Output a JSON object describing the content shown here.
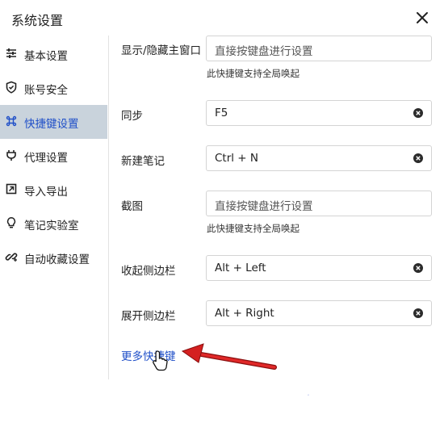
{
  "window": {
    "title": "系统设置"
  },
  "sidebar": {
    "items": [
      {
        "label": "基本设置",
        "icon": "sliders-icon",
        "active": false
      },
      {
        "label": "账号安全",
        "icon": "shield-icon",
        "active": false
      },
      {
        "label": "快捷键设置",
        "icon": "command-icon",
        "active": true
      },
      {
        "label": "代理设置",
        "icon": "plug-icon",
        "active": false
      },
      {
        "label": "导入导出",
        "icon": "import-export-icon",
        "active": false
      },
      {
        "label": "笔记实验室",
        "icon": "lightbulb-icon",
        "active": false
      },
      {
        "label": "自动收藏设置",
        "icon": "bookmark-link-icon",
        "active": false
      }
    ]
  },
  "shortcuts": [
    {
      "label": "显示/隐藏主窗口",
      "value": "",
      "placeholder": "直接按键盘进行设置",
      "hint": "此快捷键支持全局唤起"
    },
    {
      "label": "同步",
      "value": "F5",
      "placeholder": ""
    },
    {
      "label": "新建笔记",
      "value": "Ctrl + N",
      "placeholder": ""
    },
    {
      "label": "截图",
      "value": "",
      "placeholder": "直接按键盘进行设置",
      "hint": "此快捷键支持全局唤起"
    },
    {
      "label": "收起侧边栏",
      "value": "Alt + Left",
      "placeholder": ""
    },
    {
      "label": "展开侧边栏",
      "value": "Alt + Right",
      "placeholder": ""
    }
  ],
  "more_link": "更多快捷键",
  "colors": {
    "accent": "#1f4fc8",
    "active_bg": "#c9d3dc",
    "arrow": "#d42020"
  }
}
